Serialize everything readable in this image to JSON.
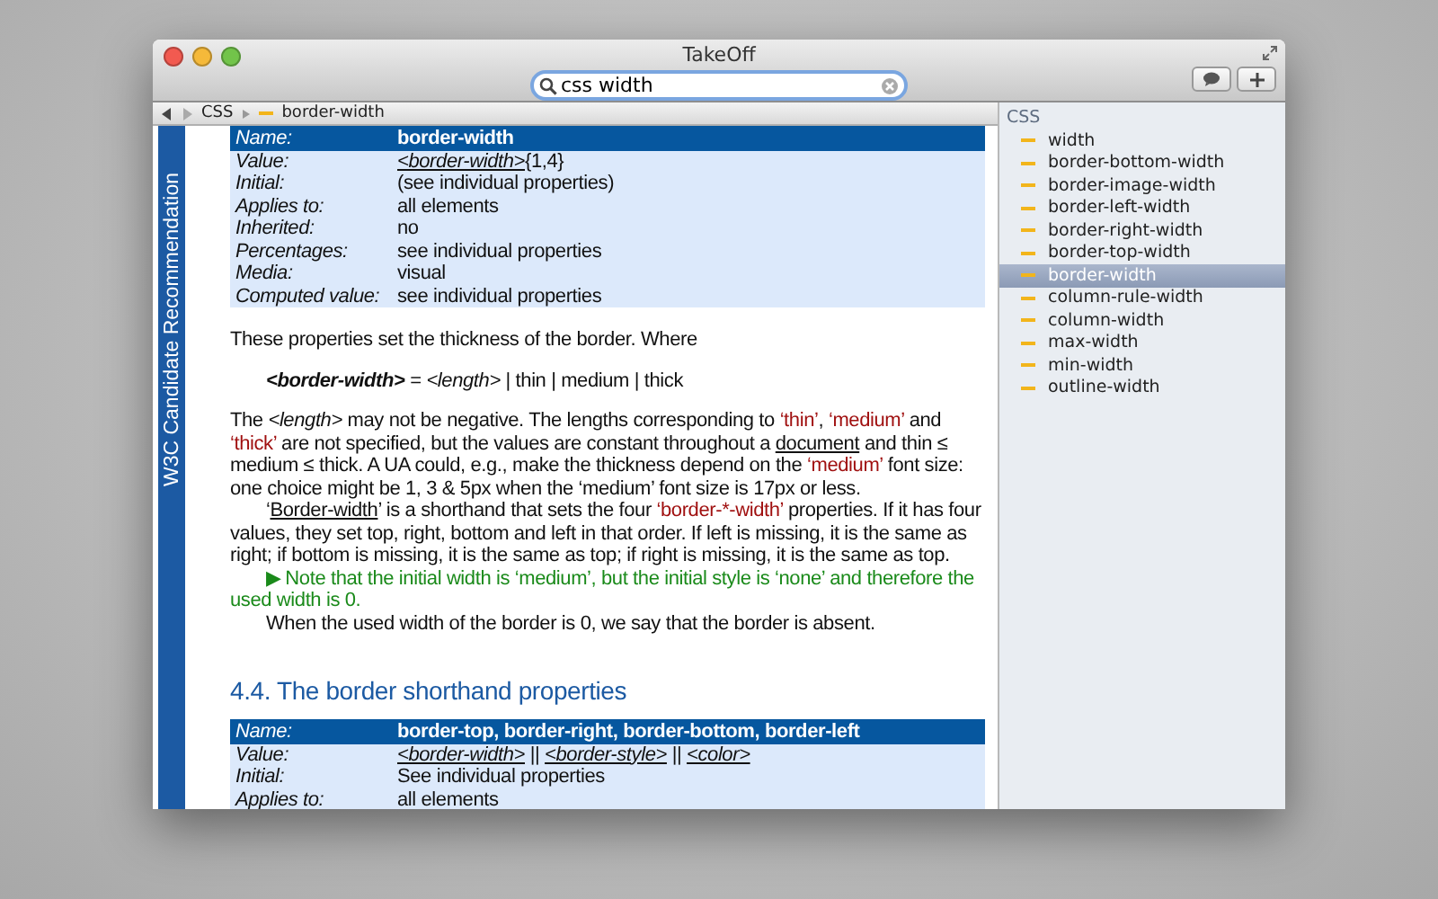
{
  "window": {
    "title": "TakeOff"
  },
  "search": {
    "value": "css width"
  },
  "breadcrumb": {
    "items": [
      "CSS",
      "border-width"
    ]
  },
  "banner": {
    "text": "W3C Candidate Recommendation"
  },
  "document": {
    "blocks": [
      {
        "kind": "table",
        "header": {
          "label": "Name:",
          "value": "border-width"
        },
        "rows": [
          {
            "label": "Value:",
            "value": [
              {
                "text": "<border-width>",
                "kind": "link"
              },
              {
                "text": "{1,4}",
                "kind": "plain"
              }
            ]
          },
          {
            "label": "Initial:",
            "value": [
              {
                "text": "(see individual properties)",
                "kind": "plain"
              }
            ]
          },
          {
            "label": "Applies to:",
            "value": [
              {
                "text": "all elements",
                "kind": "plain"
              }
            ]
          },
          {
            "label": "Inherited:",
            "value": [
              {
                "text": "no",
                "kind": "plain"
              }
            ]
          },
          {
            "label": "Percentages:",
            "value": [
              {
                "text": "see individual properties",
                "kind": "plain"
              }
            ]
          },
          {
            "label": "Media:",
            "value": [
              {
                "text": "visual",
                "kind": "plain"
              }
            ]
          },
          {
            "label": "Computed value:",
            "value": [
              {
                "text": "see individual properties",
                "kind": "plain"
              }
            ]
          }
        ]
      },
      {
        "kind": "para",
        "segments": [
          {
            "text": "These properties set the thickness of the border. Where",
            "kind": "plain"
          }
        ]
      },
      {
        "kind": "formula",
        "segments": [
          {
            "text": "<border-width>",
            "kind": "strong"
          },
          {
            "text": " = ",
            "kind": "plain"
          },
          {
            "text": "<length>",
            "kind": "italic"
          },
          {
            "text": " | thin | medium | thick",
            "kind": "plain"
          }
        ]
      },
      {
        "kind": "para",
        "segments": [
          {
            "text": "The ",
            "kind": "plain"
          },
          {
            "text": "<length>",
            "kind": "italic"
          },
          {
            "text": " may not be negative. The lengths corresponding to ",
            "kind": "plain"
          },
          {
            "text": "‘thin’",
            "kind": "term"
          },
          {
            "text": ", ",
            "kind": "plain"
          },
          {
            "text": "‘medium’",
            "kind": "term"
          },
          {
            "text": " and ",
            "kind": "plain"
          },
          {
            "text": "‘thick’",
            "kind": "term"
          },
          {
            "text": " are not specified, but the values are constant throughout a ",
            "kind": "plain"
          },
          {
            "text": "document",
            "kind": "link"
          },
          {
            "text": " and thin ≤ medium ≤ thick. A UA could, e.g., make the thickness depend on the ",
            "kind": "plain"
          },
          {
            "text": "‘medium’",
            "kind": "term"
          },
          {
            "text": " font size: one choice might be 1, 3 & 5px when the ‘medium’ font size is 17px or less.",
            "kind": "plain"
          }
        ]
      },
      {
        "kind": "indent",
        "segments": [
          {
            "text": "‘",
            "kind": "plain"
          },
          {
            "text": "Border-width",
            "kind": "link"
          },
          {
            "text": "’ is a shorthand that sets the four ",
            "kind": "plain"
          },
          {
            "text": "‘border-*-width’",
            "kind": "term"
          },
          {
            "text": " properties. If it has four values, they set top, right, bottom and left in that order. If left is missing, it is the same as right; if bottom is missing, it is the same as top; if right is missing, it is the same as top.",
            "kind": "plain"
          }
        ]
      },
      {
        "kind": "note",
        "marker": "▶",
        "segments": [
          {
            "text": "Note that the initial width is ‘medium’, but the initial style is ‘none’ and therefore the used width is 0.",
            "kind": "plain"
          }
        ]
      },
      {
        "kind": "indent",
        "segments": [
          {
            "text": "When the used width of the border is 0, we say that the border is absent.",
            "kind": "plain"
          }
        ]
      },
      {
        "kind": "heading",
        "text": "4.4. The border shorthand properties"
      },
      {
        "kind": "table",
        "header": {
          "label": "Name:",
          "value": "border-top, border-right, border-bottom, border-left"
        },
        "rows": [
          {
            "label": "Value:",
            "value": [
              {
                "text": "<border-width>",
                "kind": "link"
              },
              {
                "text": " || ",
                "kind": "plain"
              },
              {
                "text": "<border-style>",
                "kind": "link"
              },
              {
                "text": " || ",
                "kind": "plain"
              },
              {
                "text": "<color>",
                "kind": "link"
              }
            ]
          },
          {
            "label": "Initial:",
            "value": [
              {
                "text": "See individual properties",
                "kind": "plain"
              }
            ]
          },
          {
            "label": "Applies to:",
            "value": [
              {
                "text": "all elements",
                "kind": "plain"
              }
            ]
          }
        ]
      }
    ]
  },
  "sidebar": {
    "title": "CSS",
    "items": [
      {
        "label": "width",
        "selected": false
      },
      {
        "label": "border-bottom-width",
        "selected": false
      },
      {
        "label": "border-image-width",
        "selected": false
      },
      {
        "label": "border-left-width",
        "selected": false
      },
      {
        "label": "border-right-width",
        "selected": false
      },
      {
        "label": "border-top-width",
        "selected": false
      },
      {
        "label": "border-width",
        "selected": true
      },
      {
        "label": "column-rule-width",
        "selected": false
      },
      {
        "label": "column-width",
        "selected": false
      },
      {
        "label": "max-width",
        "selected": false
      },
      {
        "label": "min-width",
        "selected": false
      },
      {
        "label": "outline-width",
        "selected": false
      }
    ]
  }
}
